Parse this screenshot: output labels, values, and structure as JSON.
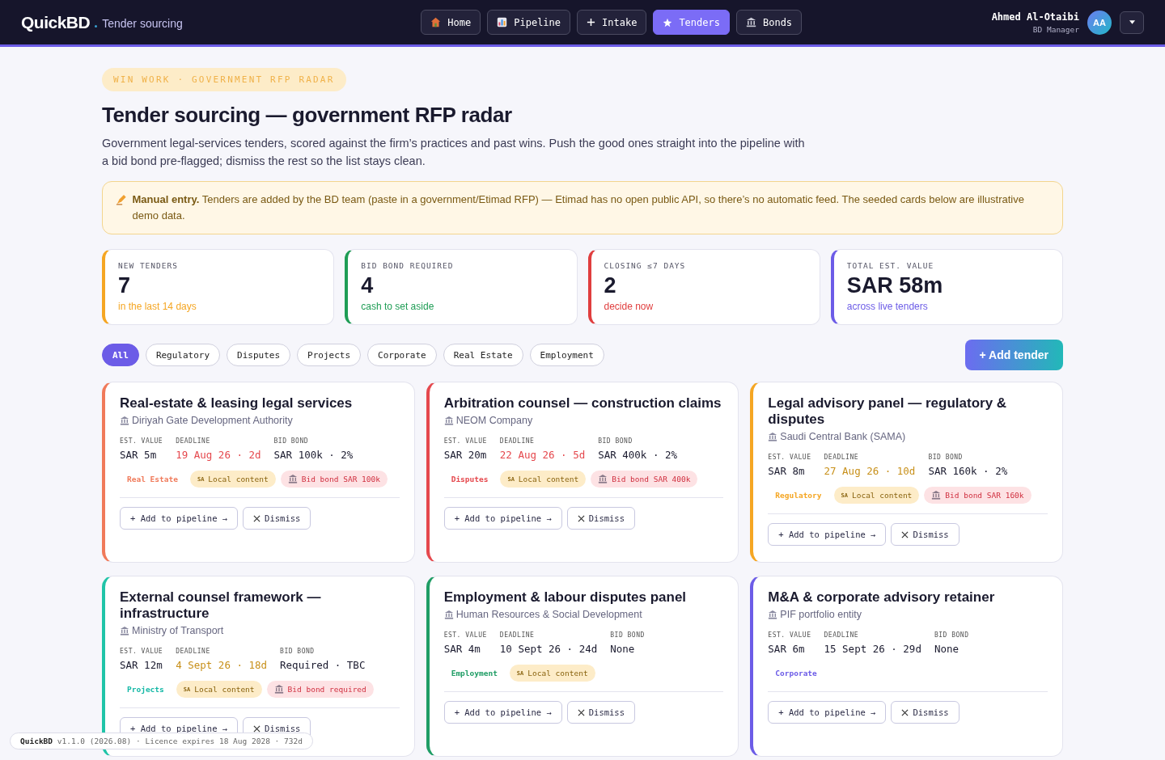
{
  "header": {
    "brand": "QuickBD",
    "section": "Tender sourcing",
    "nav": [
      {
        "label": "Home",
        "selected": false
      },
      {
        "label": "Pipeline",
        "selected": false
      },
      {
        "label": "Intake",
        "selected": false
      },
      {
        "label": "Tenders",
        "selected": true
      },
      {
        "label": "Bonds",
        "selected": false
      }
    ],
    "user": {
      "name": "Ahmed Al-Otaibi",
      "role": "BD Manager",
      "initials": "AA"
    }
  },
  "eyebrow": "WIN WORK · GOVERNMENT RFP RADAR",
  "title": "Tender sourcing — government RFP radar",
  "intro": "Government legal-services tenders, scored against the firm’s practices and past wins. Push the good ones straight into the pipeline with a bid bond pre-flagged; dismiss the rest so the list stays clean.",
  "notice": "**Manual entry.** Tenders are added by the BD team (paste in a government/Etimad RFP) — Etimad has no open public API, so there’s no automatic feed. The seeded cards below are illustrative demo data.",
  "stats": [
    {
      "label": "NEW TENDERS",
      "value": "7",
      "note": "in the last 14 days",
      "color": "#f5a623"
    },
    {
      "label": "BID BOND REQUIRED",
      "value": "4",
      "note": "cash to set aside",
      "color": "#1f9d55"
    },
    {
      "label": "CLOSING ≤7 DAYS",
      "value": "2",
      "note": "decide now",
      "color": "#e03e3e"
    },
    {
      "label": "TOTAL EST. VALUE",
      "value": "SAR 58m",
      "note": "across live tenders",
      "color": "#6c5ce7"
    }
  ],
  "filters": [
    {
      "label": "All",
      "selected": true
    },
    {
      "label": "Regulatory",
      "selected": false
    },
    {
      "label": "Disputes",
      "selected": false
    },
    {
      "label": "Projects",
      "selected": false
    },
    {
      "label": "Corporate",
      "selected": false
    },
    {
      "label": "Real Estate",
      "selected": false
    },
    {
      "label": "Employment",
      "selected": false
    }
  ],
  "add_button": "+ Add tender",
  "cards": [
    {
      "title": "Real-estate & leasing legal services",
      "agency": "Diriyah Gate Development Authority",
      "color": "#f07a5a",
      "est_value": {
        "label": "EST. VALUE",
        "value": "SAR 5m"
      },
      "deadline": {
        "label": "DEADLINE",
        "value": "19 Aug 26 · 2d",
        "color": "#e5484d"
      },
      "bid_bond": {
        "label": "BID BOND",
        "value": "SAR 100k · 2%"
      },
      "tags": [
        {
          "kind": "category",
          "label": "Real Estate",
          "color": "#f07a5a"
        },
        {
          "kind": "local",
          "flag": "SA",
          "label": "Local content"
        },
        {
          "kind": "bond",
          "label": "Bid bond SAR 100k"
        }
      ],
      "actions": [
        {
          "kind": "add",
          "label": "+ Add to pipeline →"
        },
        {
          "kind": "dismiss",
          "label": "Dismiss"
        }
      ]
    },
    {
      "title": "Arbitration counsel — construction claims",
      "agency": "NEOM Company",
      "color": "#e5484d",
      "est_value": {
        "label": "EST. VALUE",
        "value": "SAR 20m"
      },
      "deadline": {
        "label": "DEADLINE",
        "value": "22 Aug 26 · 5d",
        "color": "#e5484d"
      },
      "bid_bond": {
        "label": "BID BOND",
        "value": "SAR 400k · 2%"
      },
      "tags": [
        {
          "kind": "category",
          "label": "Disputes",
          "color": "#e5484d"
        },
        {
          "kind": "local",
          "flag": "SA",
          "label": "Local content"
        },
        {
          "kind": "bond",
          "label": "Bid bond SAR 400k"
        }
      ],
      "actions": [
        {
          "kind": "add",
          "label": "+ Add to pipeline →"
        },
        {
          "kind": "dismiss",
          "label": "Dismiss"
        }
      ]
    },
    {
      "title": "Legal advisory panel — regulatory & disputes",
      "agency": "Saudi Central Bank (SAMA)",
      "color": "#f5a623",
      "est_value": {
        "label": "EST. VALUE",
        "value": "SAR 8m"
      },
      "deadline": {
        "label": "DEADLINE",
        "value": "27 Aug 26 · 10d",
        "color": "#c8901a"
      },
      "bid_bond": {
        "label": "BID BOND",
        "value": "SAR 160k · 2%"
      },
      "tags": [
        {
          "kind": "category",
          "label": "Regulatory",
          "color": "#f5a623"
        },
        {
          "kind": "local",
          "flag": "SA",
          "label": "Local content"
        },
        {
          "kind": "bond",
          "label": "Bid bond SAR 160k"
        }
      ],
      "actions": [
        {
          "kind": "add",
          "label": "+ Add to pipeline →"
        },
        {
          "kind": "dismiss",
          "label": "Dismiss"
        }
      ]
    },
    {
      "title": "External counsel framework — infrastructure",
      "agency": "Ministry of Transport",
      "color": "#20c4a8",
      "est_value": {
        "label": "EST. VALUE",
        "value": "SAR 12m"
      },
      "deadline": {
        "label": "DEADLINE",
        "value": "4 Sept 26 · 18d",
        "color": "#c8901a"
      },
      "bid_bond": {
        "label": "BID BOND",
        "value": "Required · TBC"
      },
      "tags": [
        {
          "kind": "category",
          "label": "Projects",
          "color": "#14b8a6"
        },
        {
          "kind": "local",
          "flag": "SA",
          "label": "Local content"
        },
        {
          "kind": "bond",
          "label": "Bid bond required"
        }
      ],
      "actions": [
        {
          "kind": "add",
          "label": "+ Add to pipeline →"
        },
        {
          "kind": "dismiss",
          "label": "Dismiss"
        }
      ]
    },
    {
      "title": "Employment & labour disputes panel",
      "agency": "Human Resources & Social Development",
      "color": "#1f9d65",
      "est_value": {
        "label": "EST. VALUE",
        "value": "SAR 4m"
      },
      "deadline": {
        "label": "DEADLINE",
        "value": "10 Sept 26 · 24d",
        "color": "#1a1a2e"
      },
      "bid_bond": {
        "label": "BID BOND",
        "value": "None"
      },
      "tags": [
        {
          "kind": "category",
          "label": "Employment",
          "color": "#1f9d65"
        },
        {
          "kind": "local",
          "flag": "SA",
          "label": "Local content"
        }
      ],
      "actions": [
        {
          "kind": "add",
          "label": "+ Add to pipeline →"
        },
        {
          "kind": "dismiss",
          "label": "Dismiss"
        }
      ]
    },
    {
      "title": "M&A & corporate advisory retainer",
      "agency": "PIF portfolio entity",
      "color": "#6c5ce7",
      "est_value": {
        "label": "EST. VALUE",
        "value": "SAR 6m"
      },
      "deadline": {
        "label": "DEADLINE",
        "value": "15 Sept 26 · 29d",
        "color": "#1a1a2e"
      },
      "bid_bond": {
        "label": "BID BOND",
        "value": "None"
      },
      "tags": [
        {
          "kind": "category",
          "label": "Corporate",
          "color": "#6c5ce7"
        }
      ],
      "actions": [
        {
          "kind": "add",
          "label": "+ Add to pipeline →"
        },
        {
          "kind": "dismiss",
          "label": "Dismiss"
        }
      ]
    }
  ],
  "footer": "**QuickBD** v1.1.0 (2026.08) · Licence expires 18 Aug 2028 · 732d"
}
